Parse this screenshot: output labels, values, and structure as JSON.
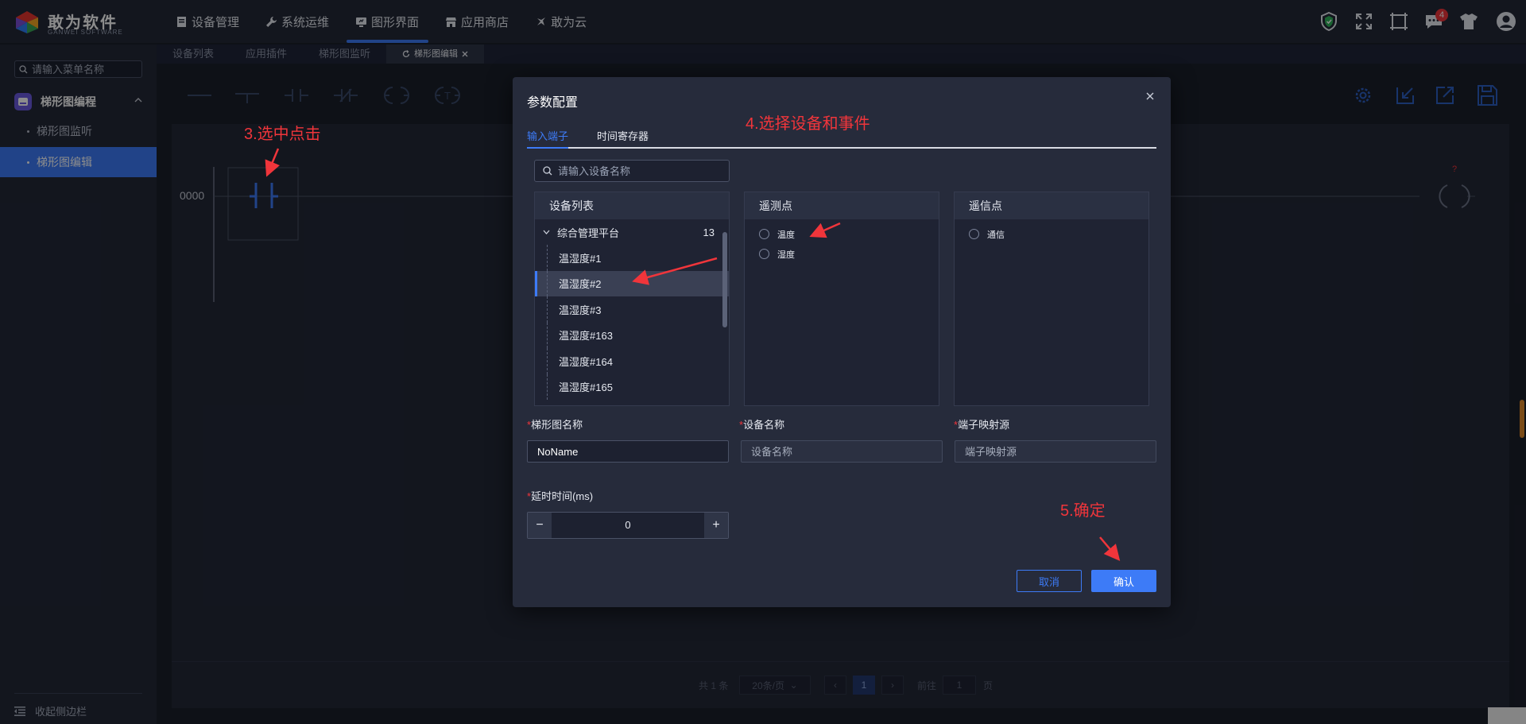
{
  "brand": {
    "name": "敢为软件",
    "sub": "GANWEI SOFTWARE"
  },
  "nav": [
    {
      "label": "设备管理",
      "icon": "doc-icon"
    },
    {
      "label": "系统运维",
      "icon": "wrench-icon"
    },
    {
      "label": "图形界面",
      "icon": "screen-icon"
    },
    {
      "label": "应用商店",
      "icon": "store-icon"
    },
    {
      "label": "敢为云",
      "icon": "cloud-icon"
    }
  ],
  "notifications": {
    "count": "4"
  },
  "tabs": [
    {
      "label": "设备列表"
    },
    {
      "label": "应用插件"
    },
    {
      "label": "梯形图监听"
    },
    {
      "label": "梯形图编辑"
    }
  ],
  "sidebar": {
    "search_placeholder": "请输入菜单名称",
    "group_label": "梯形图编程",
    "items": [
      {
        "label": "梯形图监听"
      },
      {
        "label": "梯形图编辑"
      }
    ],
    "collapse_label": "收起侧边栏"
  },
  "canvas": {
    "rung_number": "0000"
  },
  "pager": {
    "total": "共 1 条",
    "page_size": "20条/页",
    "current": "1",
    "goto_label": "前往",
    "goto_value": "1",
    "page_suffix": "页"
  },
  "dialog": {
    "title": "参数配置",
    "tabs": [
      {
        "label": "输入端子"
      },
      {
        "label": "时间寄存器"
      }
    ],
    "device_search_placeholder": "请输入设备名称",
    "device_panel": {
      "title": "设备列表",
      "root": {
        "label": "综合管理平台",
        "count": "13"
      },
      "items": [
        "温湿度#1",
        "温湿度#2",
        "温湿度#3",
        "温湿度#163",
        "温湿度#164",
        "温湿度#165"
      ],
      "selected": "温湿度#2"
    },
    "telemetry_panel": {
      "title": "遥测点",
      "items": [
        "温度",
        "湿度"
      ]
    },
    "telesignal_panel": {
      "title": "遥信点",
      "items": [
        "通信"
      ]
    },
    "fields": {
      "ladder_name": {
        "label": "梯形图名称",
        "value": "NoName"
      },
      "device_name": {
        "label": "设备名称",
        "placeholder": "设备名称"
      },
      "terminal_source": {
        "label": "端子映射源",
        "placeholder": "端子映射源"
      },
      "delay": {
        "label": "延时时间(ms)",
        "value": "0",
        "minus": "−",
        "plus": "+"
      }
    },
    "buttons": {
      "cancel": "取消",
      "ok": "确认"
    }
  },
  "annotations": {
    "step3": "3.选中点击",
    "step4": "4.选择设备和事件",
    "step5": "5.确定"
  },
  "colors": {
    "accent": "#3d7bf7",
    "annotation": "#f0353b",
    "background": "#1b1f2b"
  }
}
